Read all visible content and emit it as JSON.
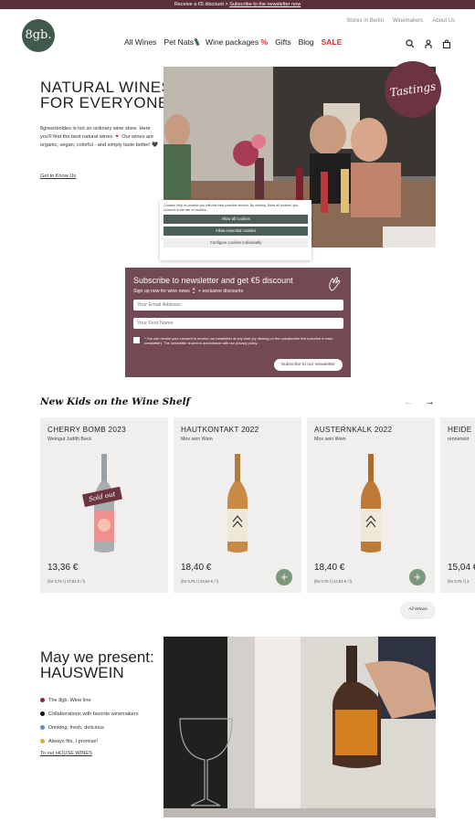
{
  "promo": {
    "text": "Receive a €5 discount > ",
    "link": "Subscribe to the newsletter now"
  },
  "logo": {
    "text": "8gb."
  },
  "toplinks": [
    "Stores in Berlin",
    "Winemakers",
    "About Us"
  ],
  "nav": {
    "all_wines": "All Wines",
    "pet_nats": "Pet Nats",
    "wine_packages": "Wine packages",
    "wine_packages_suffix": "%",
    "gifts": "Gifts",
    "blog": "Blog",
    "sale": "SALE"
  },
  "hero": {
    "title_line1": "NATURAL WINES",
    "title_line2": "FOR EVERYONE",
    "text": "8greenbottles is not an ordinary wine store. Here you'll find the best natural wines 🍷 Our wines are organic, vegan, colorful - and simply taste better! 🖤",
    "link": "Get to Know Us",
    "badge": "Tastings"
  },
  "cookie": {
    "text": "Cookies help us provide you with the best possible service. By clicking 'Allow all cookies' you consent to the use of cookies.",
    "allow_all": "Allow all cookies",
    "allow_essential": "Allow essential cookies",
    "configure": "Configure cookies individually"
  },
  "newsletter": {
    "title": "Subscribe to newsletter and get €5 discount",
    "subtitle": "Sign up now for wine news 🍷 + exclusive discounts",
    "email_placeholder": "Your Email Address",
    "name_placeholder": "Your First Name",
    "consent": "* You can revoke your consent to receive our newsletter at any time (by clicking on the unsubscribe link included in each newsletter). The newsletter is sent in accordance with our privacy policy.",
    "button": "Subscribe to our newsletter"
  },
  "shelf": {
    "title": "New Kids on the Wine Shelf",
    "cards": [
      {
        "name": "CHERRY BOMB 2023",
        "maker": "Weingut Judith Beck",
        "price": "13,36 €",
        "unit": "(for 0,75 l | 17,81 € / l)",
        "sold_out": "Sold out"
      },
      {
        "name": "HAUTKONTAKT 2022",
        "maker": "Mox sein Wein",
        "price": "18,40 €",
        "unit": "(for 0,75 l | 24,54 € / l)"
      },
      {
        "name": "AUSTERNKALK 2022",
        "maker": "Mox sein Wein",
        "price": "18,40 €",
        "unit": "(for 0,75 l | 24,54 € / l)"
      },
      {
        "name": "HEIDE",
        "maker": "rennersist",
        "price": "15,04 €",
        "unit": "(for 0,75 l | 2"
      }
    ],
    "all_wines": "All Wines"
  },
  "house": {
    "title_line1": "May we present:",
    "title_line2": "HAUSWEIN",
    "items": [
      "The 8gb. Wine line",
      "Collaborations with favorite winemakers",
      "Drinking, fresh, delicious",
      "Always fits, I promise!"
    ],
    "link": "To our HOUSE WINES"
  },
  "colors": {
    "brand_green": "#3f5a4b",
    "wine_red": "#6b3440",
    "newsletter_bg": "#734953",
    "sale_red": "#d42d2d",
    "add_green": "#7a9a7b"
  }
}
